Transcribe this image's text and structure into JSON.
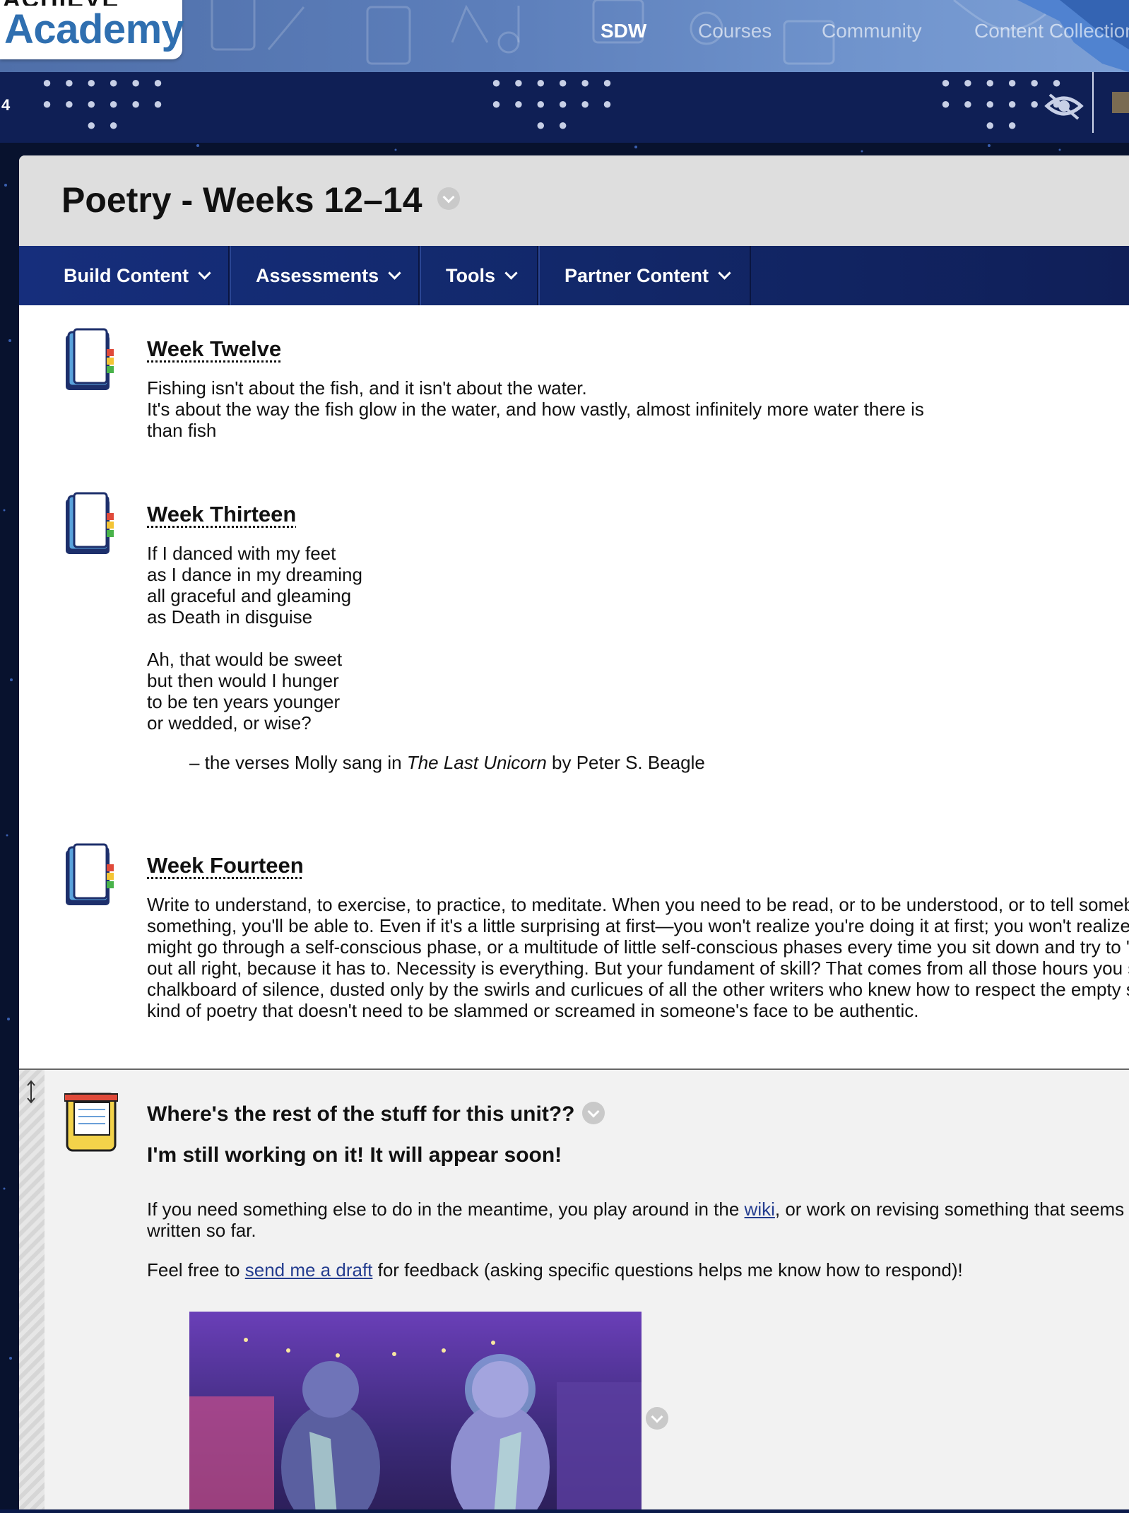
{
  "header": {
    "logo_top": "ACHIEVE",
    "logo_text": "Academy",
    "nav": [
      {
        "label": "SDW",
        "active": true
      },
      {
        "label": "Courses",
        "active": false
      },
      {
        "label": "Community",
        "active": false
      },
      {
        "label": "Content Collection",
        "active": false
      }
    ]
  },
  "band": {
    "number": "4"
  },
  "page": {
    "title": "Poetry - Weeks 12–14"
  },
  "toolbar": {
    "build": "Build Content",
    "assessments": "Assessments",
    "tools": "Tools",
    "partner": "Partner Content"
  },
  "items": [
    {
      "title": "Week Twelve",
      "body": "Fishing isn't about the fish, and it isn't about the water.\nIt's about the way the fish glow in the water, and how vastly, almost infinitely more water there is\nthan fish"
    },
    {
      "title": "Week Thirteen",
      "body": "If I danced with my feet\nas I dance in my dreaming\nall graceful and gleaming\nas Death in disguise\n\nAh, that would be sweet\nbut then would I hunger\nto be ten years younger\nor wedded, or wise?",
      "attrib_pre": "– the verses Molly sang in ",
      "attrib_book": "The Last Unicorn",
      "attrib_post": " by Peter S. Beagle"
    },
    {
      "title": "Week Fourteen",
      "body": "Write to understand, to exercise, to practice, to meditate. When you need to be read, or to be understood, or to tell someb\nsomething, you'll be able to. Even if it's a little surprising at first—you won't realize you're doing it at first; you won't realize\nmight go through a self-conscious phase, or a multitude of little self-conscious phases every time you sit down and try to '\nout all right, because it has to. Necessity is everything. But your fundament of skill? That comes from all those hours you s\nchalkboard of silence, dusted only by the swirls and curlicues of all the other writers who knew how to respect the empty s\nkind of poetry that doesn't need to be slammed or screamed in someone's face to be authentic."
    }
  ],
  "note": {
    "title": "Where's the rest of the stuff for this unit??",
    "subtitle": "I'm still working on it! It will appear soon!",
    "p1_pre": "If you need something else to do in the meantime, you play around in the ",
    "p1_link": "wiki",
    "p1_post": ", or work on revising something that seems",
    "p1_line2": "written so far.",
    "p2_pre": "Feel free to ",
    "p2_link": "send me a draft",
    "p2_post": " for feedback (asking specific questions helps me know how to respond)!"
  },
  "icons": {
    "item_icon": "notebook-icon",
    "note_icon": "notepad-icon",
    "view_icon": "eye-icon",
    "move_handle": "move-handle-icon"
  },
  "colors": {
    "accent_blue": "#162e7c",
    "link": "#243d8f",
    "logo_blue": "#2f6fb0"
  }
}
